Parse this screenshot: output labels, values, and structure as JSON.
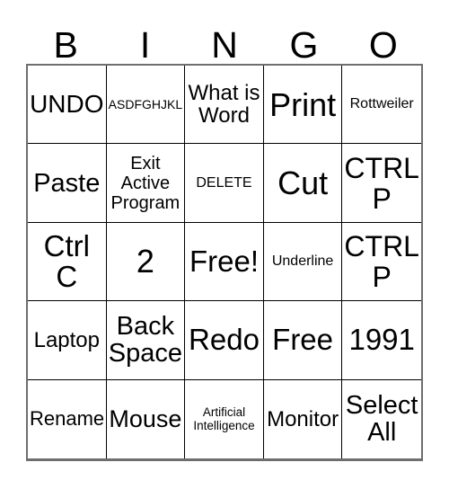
{
  "card": {
    "title": "BINGO Card",
    "header_letters": [
      "B",
      "I",
      "N",
      "G",
      "O"
    ],
    "grid_size": "5x5",
    "colors": {
      "background": "#ffffff",
      "text": "#000000",
      "cell_border": "#000000",
      "outer_border": "#6e6e6e"
    },
    "cells": [
      {
        "text": "UNDO",
        "size": "lg",
        "lines": 1
      },
      {
        "text": "ASDFGHJKL",
        "size": "xs",
        "lines": 1
      },
      {
        "text": "What is\nWord",
        "size": "md",
        "lines": 2
      },
      {
        "text": "Print",
        "size": "xxl",
        "lines": 1
      },
      {
        "text": "Rottweiler",
        "size": "xs",
        "lines": 1
      },
      {
        "text": "Paste",
        "size": "lg",
        "lines": 1
      },
      {
        "text": "Exit\nActive\nProgram",
        "size": "sm",
        "lines": 3
      },
      {
        "text": "DELETE",
        "size": "xs",
        "lines": 1
      },
      {
        "text": "Cut",
        "size": "xxl",
        "lines": 1
      },
      {
        "text": "CTRL\nP",
        "size": "xl",
        "lines": 2
      },
      {
        "text": "Ctrl\nC",
        "size": "xl",
        "lines": 2
      },
      {
        "text": "2",
        "size": "xxl",
        "lines": 1
      },
      {
        "text": "Free!",
        "size": "xl",
        "lines": 1
      },
      {
        "text": "Underline",
        "size": "xs",
        "lines": 1
      },
      {
        "text": "CTRL\nP",
        "size": "xl",
        "lines": 2
      },
      {
        "text": "Laptop",
        "size": "md",
        "lines": 1
      },
      {
        "text": "Back\nSpace",
        "size": "lg",
        "lines": 2
      },
      {
        "text": "Redo",
        "size": "xl",
        "lines": 1
      },
      {
        "text": "Free",
        "size": "xl",
        "lines": 1
      },
      {
        "text": "1991",
        "size": "xl",
        "lines": 1
      },
      {
        "text": "Rename",
        "size": "md",
        "lines": 1
      },
      {
        "text": "Mouse",
        "size": "lg",
        "lines": 1
      },
      {
        "text": "Artificial\nIntelligence",
        "size": "xxs",
        "lines": 2
      },
      {
        "text": "Monitor",
        "size": "md",
        "lines": 1
      },
      {
        "text": "Select\nAll",
        "size": "lg",
        "lines": 2
      }
    ]
  }
}
